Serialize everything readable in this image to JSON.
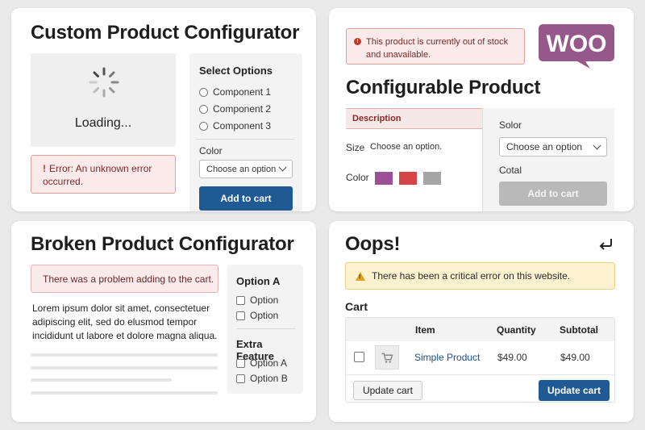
{
  "panel1": {
    "title": "Custom Product Configurator",
    "loading_text": "Loading...",
    "error_text": "Error: An unknown error occurred.",
    "options_heading": "Select Options",
    "components": [
      "Component 1",
      "Component 2",
      "Component 3"
    ],
    "color_label": "Color",
    "color_select": "Choose an option",
    "add_to_cart": "Add to cart"
  },
  "panel2": {
    "notice": "This product is currently out of stock and unavailable.",
    "logo_text": "WOO",
    "title": "Configurable Product",
    "description_tab": "Description",
    "size_label": "Size",
    "size_value": "Choose an option.",
    "color_label": "Color",
    "swatches": [
      "#9b4f96",
      "#d64545",
      "#a6a6a6"
    ],
    "side_label1": "Solor",
    "select_value": "Choose an option",
    "side_label2": "Cotal",
    "add_to_cart": "Add to cart"
  },
  "panel3": {
    "title": "Broken Product Configurator",
    "error_text": "There was a problem adding to the cart.",
    "lorem": "Lorem ipsum dolor sit amet, consectetuer adipiscing elit, sed do elusmod tempor incididunt ut labore et dolore magna  aliqua.",
    "option_a_heading": "Option A",
    "option_a_items": [
      "Option",
      "Option"
    ],
    "extra_heading": "Extra Feature",
    "extra_items": [
      "Option A",
      "Option B"
    ]
  },
  "panel4": {
    "title": "Oops!",
    "notice": "There has been a critical error on this website.",
    "cart_heading": "Cart",
    "columns": [
      "Item",
      "Quantity",
      "Subtotal"
    ],
    "row": {
      "item": "Simple Product",
      "quantity": "$49.00",
      "subtotal": "$49.00"
    },
    "update_left": "Update cart",
    "update_right": "Update cart"
  },
  "colors": {
    "primary": "#1f5a94",
    "woo_purple": "#96588a",
    "error_bg": "#fbeaea",
    "warning_bg": "#fdf2cf"
  }
}
